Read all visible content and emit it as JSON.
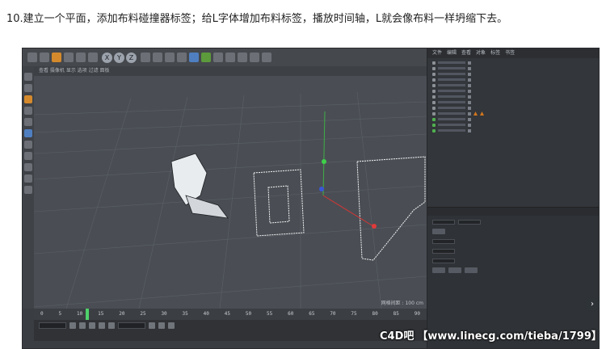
{
  "caption": {
    "text": "10.建立一个平面，添加布料碰撞器标签；给L字体增加布料标签，播放时间轴，L就会像布料一样坍缩下去。"
  },
  "viewport": {
    "menu": "查看 摄像机 显示 选项 过滤 面板",
    "grid_label": "网格间距 : 100 cm"
  },
  "toolbar": {
    "axis_x": "X",
    "axis_y": "Y",
    "axis_z": "Z"
  },
  "object_manager": {
    "tabs": [
      "文件",
      "编辑",
      "查看",
      "对象",
      "标签",
      "书签"
    ]
  },
  "timeline": {
    "ticks": [
      "0",
      "5",
      "10",
      "15",
      "20",
      "25",
      "30",
      "35",
      "40",
      "45",
      "50",
      "55",
      "60",
      "65",
      "70",
      "75",
      "80",
      "85",
      "90"
    ],
    "current_frame": "11",
    "start_field": "0 F",
    "end_field": "90 F",
    "playhead_fraction": 0.12
  },
  "watermark": {
    "logo": "C4D吧",
    "link": "【www.linecg.com/tieba/1799】"
  },
  "scroll": {
    "glyph": "›"
  },
  "colors": {
    "viewport_bg": "#4a4e54",
    "panel_bg": "#33363a",
    "accent_orange": "#d48a2c",
    "playhead_green": "#4fd16a"
  }
}
